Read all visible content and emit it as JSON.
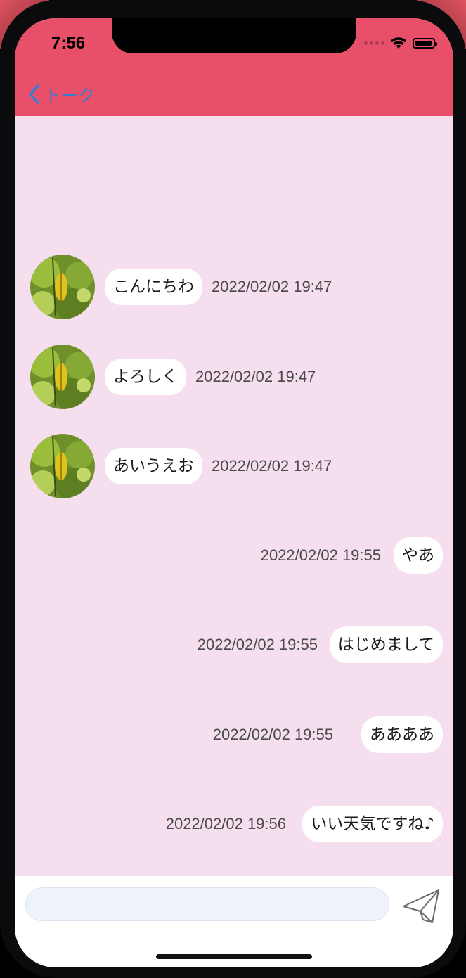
{
  "status_bar": {
    "time": "7:56",
    "icons": [
      "signal-dots-icon",
      "wifi-icon",
      "battery-icon"
    ],
    "battery_level": 0.95
  },
  "nav": {
    "back_label": "トーク",
    "back_icon": "chevron-left-icon",
    "header_color": "#e8506a",
    "link_color": "#3a7bd5"
  },
  "chat": {
    "background_color": "#f5deee",
    "incoming": [
      {
        "text": "こんにちわ",
        "timestamp": "2022/02/02 19:47"
      },
      {
        "text": "よろしく",
        "timestamp": "2022/02/02 19:47"
      },
      {
        "text": "あいうえお",
        "timestamp": "2022/02/02 19:47"
      }
    ],
    "outgoing": [
      {
        "text": "やあ",
        "timestamp": "2022/02/02 19:55"
      },
      {
        "text": "はじめまして",
        "timestamp": "2022/02/02 19:55"
      },
      {
        "text": "ああああ",
        "timestamp": "2022/02/02 19:55"
      },
      {
        "text": "いい天気ですね♪",
        "timestamp": "2022/02/02 19:56"
      }
    ]
  },
  "composer": {
    "input_value": "",
    "input_placeholder": "",
    "send_icon": "paper-plane-icon"
  }
}
